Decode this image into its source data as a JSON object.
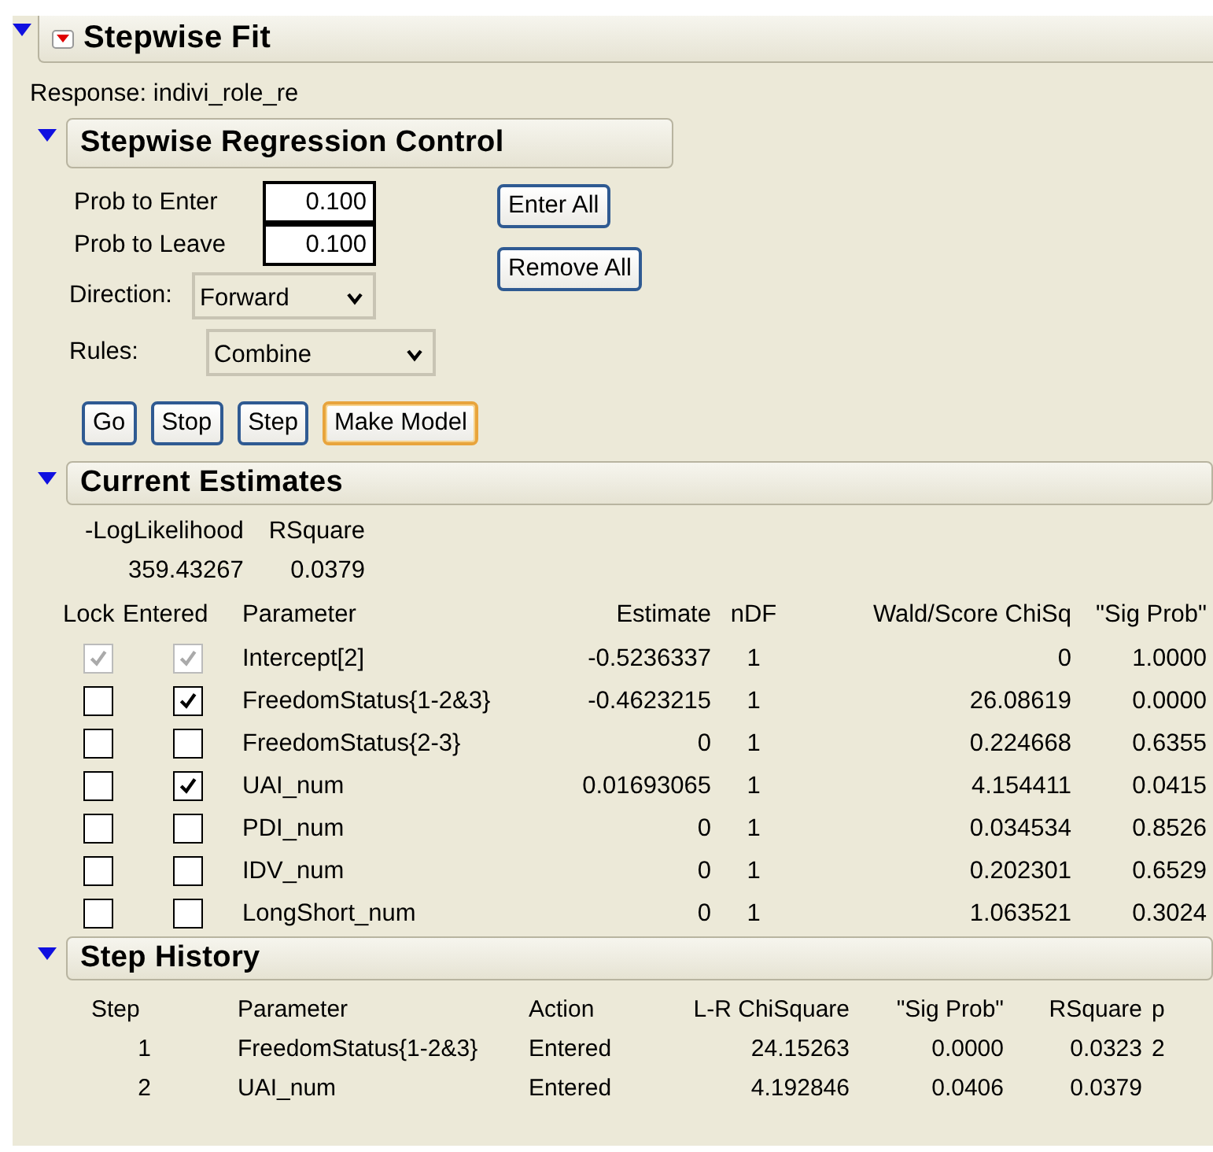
{
  "report": {
    "title": "Stepwise Fit",
    "expanded": true,
    "response": "Response: indivi_role_re"
  },
  "control": {
    "title": "Stepwise Regression Control",
    "expanded": true,
    "prob_enter": {
      "label": "Prob to Enter",
      "value": "0.100"
    },
    "prob_leave": {
      "label": "Prob to Leave",
      "value": "0.100"
    },
    "direction": {
      "label": "Direction:",
      "value": "Forward"
    },
    "rules": {
      "label": "Rules:",
      "value": "Combine"
    },
    "side_buttons": [
      "Enter All",
      "Remove All"
    ],
    "buttons": [
      {
        "label": "Go",
        "focused": false
      },
      {
        "label": "Stop",
        "focused": false
      },
      {
        "label": "Step",
        "focused": false
      },
      {
        "label": "Make Model",
        "focused": true
      }
    ]
  },
  "estimates": {
    "title": "Current Estimates",
    "expanded": true,
    "summary_columns": [
      "-LogLikelihood",
      "RSquare"
    ],
    "summary_values": [
      "359.43267",
      "0.0379"
    ],
    "columns": [
      "Lock",
      "Entered",
      "Parameter",
      "Estimate",
      "nDF",
      "Wald/Score ChiSq",
      "\"Sig Prob\""
    ],
    "rows": [
      {
        "lock": true,
        "entered": true,
        "disabled": true,
        "parameter": "Intercept[2]",
        "estimate": "-0.5236337",
        "ndf": "1",
        "chisq": "0",
        "sig_prob": "1.0000"
      },
      {
        "lock": false,
        "entered": true,
        "disabled": false,
        "parameter": "FreedomStatus{1-2&3}",
        "estimate": "-0.4623215",
        "ndf": "1",
        "chisq": "26.08619",
        "sig_prob": "0.0000"
      },
      {
        "lock": false,
        "entered": false,
        "disabled": false,
        "parameter": "FreedomStatus{2-3}",
        "estimate": "0",
        "ndf": "1",
        "chisq": "0.224668",
        "sig_prob": "0.6355"
      },
      {
        "lock": false,
        "entered": true,
        "disabled": false,
        "parameter": "UAI_num",
        "estimate": "0.01693065",
        "ndf": "1",
        "chisq": "4.154411",
        "sig_prob": "0.0415"
      },
      {
        "lock": false,
        "entered": false,
        "disabled": false,
        "parameter": "PDI_num",
        "estimate": "0",
        "ndf": "1",
        "chisq": "0.034534",
        "sig_prob": "0.8526"
      },
      {
        "lock": false,
        "entered": false,
        "disabled": false,
        "parameter": "IDV_num",
        "estimate": "0",
        "ndf": "1",
        "chisq": "0.202301",
        "sig_prob": "0.6529"
      },
      {
        "lock": false,
        "entered": false,
        "disabled": false,
        "parameter": "LongShort_num",
        "estimate": "0",
        "ndf": "1",
        "chisq": "1.063521",
        "sig_prob": "0.3024"
      }
    ]
  },
  "history": {
    "title": "Step History",
    "expanded": true,
    "columns": [
      "Step",
      "Parameter",
      "Action",
      "L-R ChiSquare",
      "\"Sig Prob\"",
      "RSquare",
      "p"
    ],
    "rows": [
      [
        "1",
        "FreedomStatus{1-2&3}",
        "Entered",
        "24.15263",
        "0.0000",
        "0.0323",
        "2"
      ],
      [
        "2",
        "UAI_num",
        "Entered",
        "4.192846",
        "0.0406",
        "0.0379",
        ""
      ]
    ]
  }
}
